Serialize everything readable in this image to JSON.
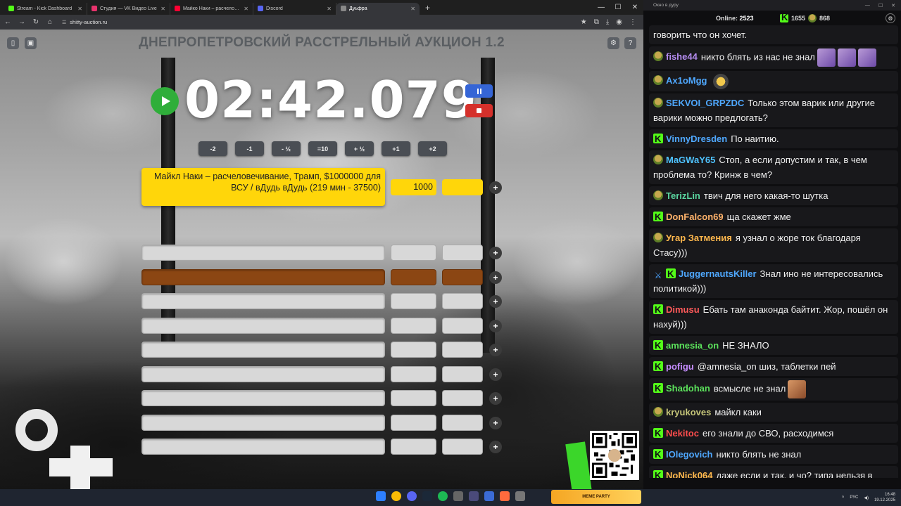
{
  "browser": {
    "tabs": [
      {
        "label": "Stream - Kick Dashboard",
        "fav": "#53fc18"
      },
      {
        "label": "Студия — VK Видео Live",
        "fav": "#e8336d"
      },
      {
        "label": "Майко Наки – расчеловечива...",
        "fav": "#ff0033"
      },
      {
        "label": "Discord",
        "fav": "#5865f2"
      },
      {
        "label": "Дуьфра",
        "fav": "#888888",
        "active": true
      }
    ],
    "new_tab": "+",
    "url": "shitty-auction.ru"
  },
  "app": {
    "title": "ДНЕПРОПЕТРОВСКИЙ РАССТРЕЛЬНЫЙ АУКЦИОН 1.2",
    "timer": "02:42.079",
    "adjust_buttons": [
      "-2",
      "-1",
      "- ½",
      "=10",
      "+ ½",
      "+1",
      "+2"
    ],
    "lead_lot": {
      "name": "Майкл Наки – расчеловечивание, Трамп, $1000000 для ВСУ / вДудь вДудь (219 мин - 37500)",
      "amount": "1000",
      "percent": ""
    },
    "empty_lot_count": 9,
    "plus_label": "+"
  },
  "chat": {
    "window_title": "Окно в дуру",
    "online_label": "Online:",
    "online_count": "2523",
    "kick_count": "1655",
    "other_count": "868",
    "messages": [
      {
        "badge": "",
        "user": "",
        "color": "#efefef",
        "text": "говорить что он хочет."
      },
      {
        "badge": "pepe",
        "user": "fishe44",
        "color": "#b48cf0",
        "text": "никто блять из нас не знал",
        "emotes": 3
      },
      {
        "badge": "pepe",
        "user": "Ax1oMgg",
        "color": "#4fa8ff",
        "text": "",
        "emotes": 1,
        "duck": true
      },
      {
        "badge": "pepe",
        "user": "SEKVOI_GRPZDC",
        "color": "#4fa8ff",
        "text": "Только этом варик или другие варики можно предлогать?"
      },
      {
        "badge": "kick",
        "user": "VinnyDresden",
        "color": "#4fa8ff",
        "text": "По наитию."
      },
      {
        "badge": "pepe",
        "user": "MaGWaY65",
        "color": "#4fc3ff",
        "text": "Стоп, а если допустим и так, в чем проблема то? Кринж в чем?"
      },
      {
        "badge": "pepe",
        "user": "TerizLin",
        "color": "#5ad6a0",
        "text": "твич для него какая-то шутка"
      },
      {
        "badge": "kick",
        "user": "DonFalcon69",
        "color": "#ffb36b",
        "text": "ща скажет жме"
      },
      {
        "badge": "pepe",
        "user": "Угар Затмения",
        "color": "#ffb84d",
        "text": "я узнал о жоре ток благодаря Стасу)))"
      },
      {
        "badge": "sword",
        "user": "JuggernautsKiller",
        "color": "#4fa8ff",
        "text": "Знал ино не интересовались политикой)))"
      },
      {
        "badge": "kick",
        "user": "Dimusu",
        "color": "#ff5a5a",
        "text": "Ебать там анаконда байтит. Жор, пошёл он нахуй)))"
      },
      {
        "badge": "kick",
        "user": "amnesia_on",
        "color": "#5ce35c",
        "text": "НЕ ЗНАЛО"
      },
      {
        "badge": "kick",
        "user": "pofigu",
        "color": "#c58cff",
        "text": "@amnesia_on шиз, таблетки пей"
      },
      {
        "badge": "kick",
        "user": "Shadohan",
        "color": "#5ce35c",
        "text": "всмысле не знал",
        "emotes": 1,
        "face": true
      },
      {
        "badge": "pepe",
        "user": "kryukoves",
        "color": "#c7c77a",
        "text": "майкл каки"
      },
      {
        "badge": "kick",
        "user": "Nekitoc",
        "color": "#ff4d4d",
        "text": "его знали до СВО, расходимся"
      },
      {
        "badge": "kick",
        "user": "IOlegovich",
        "color": "#4fa8ff",
        "text": "никто блять не знал"
      },
      {
        "badge": "kick",
        "user": "NoNick064",
        "color": "#ffb84d",
        "text": "даже если и так. и чо? типа нельзя в меди выходить или как?"
      }
    ]
  },
  "taskbar": {
    "banner": "MEME PARTY",
    "lang": "РУС",
    "time": "16:48",
    "date": "19.12.2025"
  }
}
